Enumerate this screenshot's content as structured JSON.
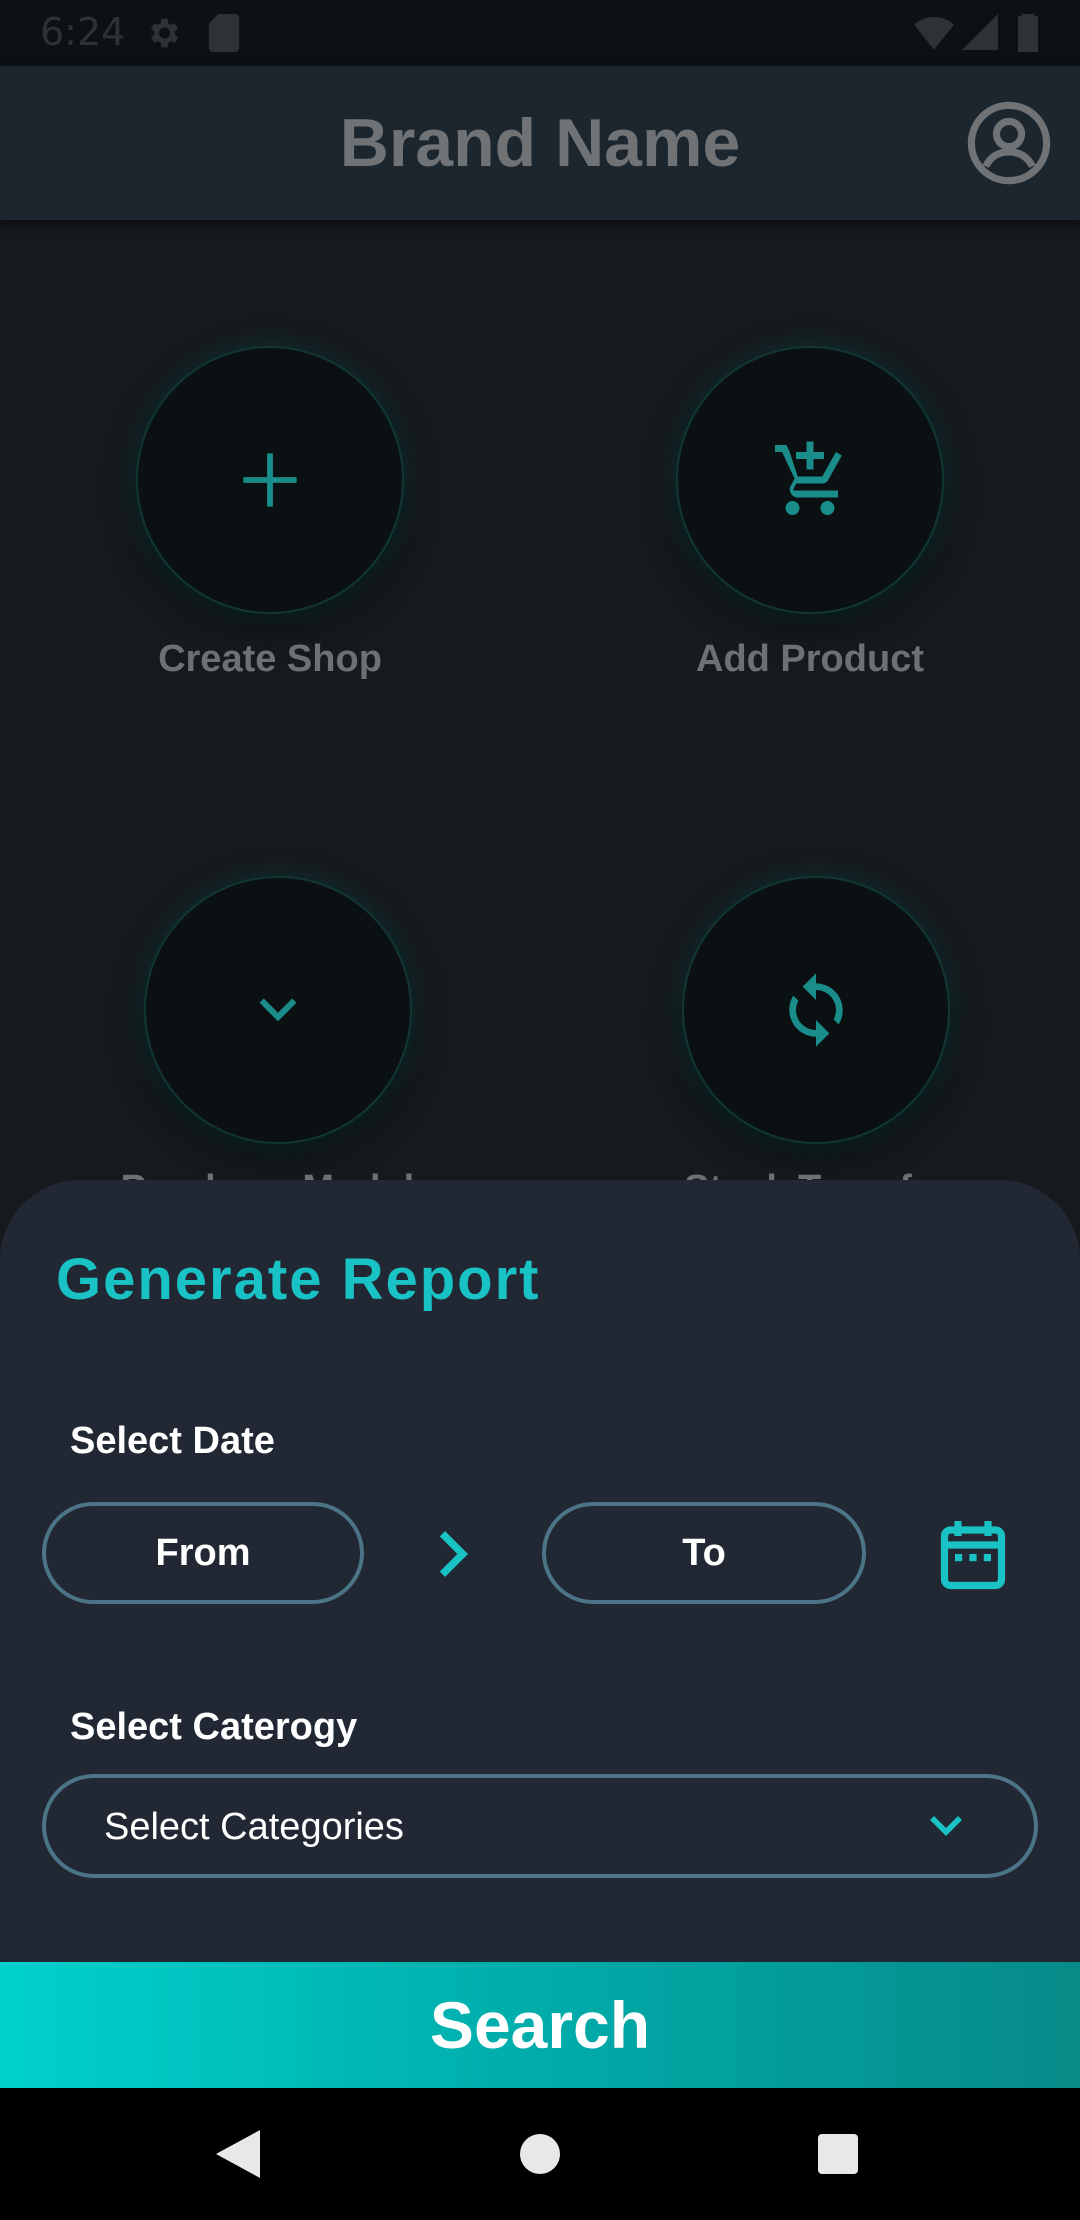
{
  "status_bar": {
    "time": "6:24",
    "icons": [
      "gear-icon",
      "sd-card-icon",
      "wifi-icon",
      "signal-icon",
      "battery-icon"
    ]
  },
  "app_bar": {
    "title": "Brand Name",
    "account_icon": "account-circle-icon"
  },
  "tiles": [
    {
      "label": "Create Shop",
      "icon": "plus-icon"
    },
    {
      "label": "Add Product",
      "icon": "cart-plus-icon"
    },
    {
      "label": "Purchase Module",
      "icon": "chevron-down-icon"
    },
    {
      "label": "Stock Transfer",
      "icon": "sync-icon"
    }
  ],
  "sheet": {
    "title": "Generate Report",
    "date_section_label": "Select Date",
    "from_label": "From",
    "to_label": "To",
    "category_section_label": "Select Caterogy",
    "category_select_value": "Select Categories",
    "search_label": "Search"
  },
  "colors": {
    "accent": "#19c2c4",
    "sheet_background": "#222833",
    "pill_border": "#4b7587",
    "search_gradient_start": "#00d1cd",
    "search_gradient_end": "#078a88"
  }
}
